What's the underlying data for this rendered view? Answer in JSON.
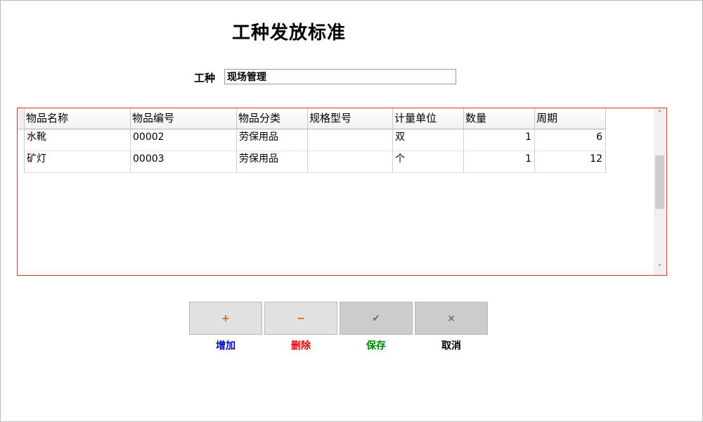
{
  "title": "工种发放标准",
  "form": {
    "label": "工种",
    "value": "现场管理"
  },
  "table": {
    "columns": [
      "物品名称",
      "物品编号",
      "物品分类",
      "规格型号",
      "计量单位",
      "数量",
      "周期"
    ],
    "rows": [
      [
        "水靴",
        "00002",
        "劳保用品",
        "",
        "双",
        "1",
        "6"
      ],
      [
        "矿灯",
        "00003",
        "劳保用品",
        "",
        "个",
        "1",
        "12"
      ]
    ],
    "scroll_up": "˄",
    "scroll_down": "˅"
  },
  "buttons": [
    {
      "id": "add",
      "icon": "+",
      "icon_name": "plus-icon",
      "icon_color": "#e05a00",
      "label": "增加",
      "label_color": "#0000c8"
    },
    {
      "id": "delete",
      "icon": "−",
      "icon_name": "minus-icon",
      "icon_color": "#e05a00",
      "label": "删除",
      "label_color": "#e00000"
    },
    {
      "id": "save",
      "icon": "✔",
      "icon_name": "check-icon",
      "icon_color": "#707070",
      "label": "保存",
      "label_color": "#008000"
    },
    {
      "id": "cancel",
      "icon": "×",
      "icon_name": "close-icon",
      "icon_color": "#707070",
      "label": "取消",
      "label_color": "#000000"
    }
  ]
}
